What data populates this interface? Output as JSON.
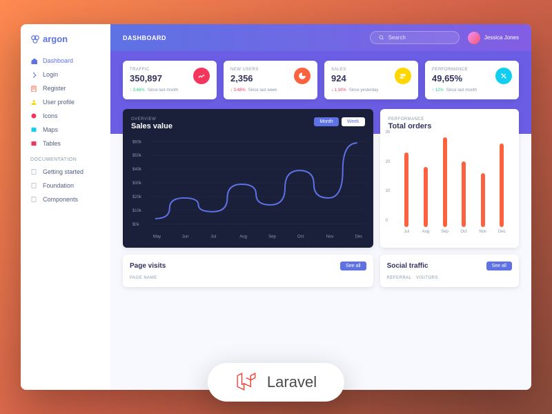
{
  "brand": "argon",
  "header": {
    "title": "DASHBOARD",
    "search_placeholder": "Search",
    "user_name": "Jessica Jones"
  },
  "nav": {
    "items": [
      {
        "label": "Dashboard",
        "icon": "home",
        "color": "#5e72e4"
      },
      {
        "label": "Login",
        "icon": "login",
        "color": "#5e72e4"
      },
      {
        "label": "Register",
        "icon": "register",
        "color": "#fb6340"
      },
      {
        "label": "User profile",
        "icon": "user",
        "color": "#ffd600"
      },
      {
        "label": "Icons",
        "icon": "icons",
        "color": "#f5365c"
      },
      {
        "label": "Maps",
        "icon": "map",
        "color": "#11cdef"
      },
      {
        "label": "Tables",
        "icon": "table",
        "color": "#f5365c"
      }
    ],
    "doc_title": "DOCUMENTATION",
    "doc_items": [
      {
        "label": "Getting started"
      },
      {
        "label": "Foundation"
      },
      {
        "label": "Components"
      }
    ]
  },
  "stats": [
    {
      "label": "TRAFFIC",
      "value": "350,897",
      "delta": "3.48%",
      "dir": "up",
      "since": "Since last month",
      "color": "#f5365c"
    },
    {
      "label": "NEW USERS",
      "value": "2,356",
      "delta": "3.48%",
      "dir": "down",
      "since": "Since last week",
      "color": "#fb6340"
    },
    {
      "label": "SALES",
      "value": "924",
      "delta": "1.10%",
      "dir": "down",
      "since": "Since yesterday",
      "color": "#ffd600"
    },
    {
      "label": "PERFORMANCE",
      "value": "49,65%",
      "delta": "12%",
      "dir": "up",
      "since": "Since last month",
      "color": "#11cdef"
    }
  ],
  "sales_chart": {
    "sub": "OVERVIEW",
    "title": "Sales value",
    "tab_month": "Month",
    "tab_week": "Week"
  },
  "orders_chart": {
    "sub": "PERFORMANCE",
    "title": "Total orders"
  },
  "page_visits": {
    "title": "Page visits",
    "see_all": "See all",
    "col1": "PAGE NAME"
  },
  "social": {
    "title": "Social traffic",
    "see_all": "See all",
    "col1": "REFERRAL",
    "col2": "VISITORS"
  },
  "badge": "Laravel",
  "chart_data": [
    {
      "type": "line",
      "title": "Sales value",
      "x": [
        "May",
        "Jun",
        "Jul",
        "Aug",
        "Sep",
        "Oct",
        "Nov",
        "Dec"
      ],
      "values": [
        5,
        20,
        10,
        30,
        15,
        40,
        20,
        60
      ],
      "ylabel": "",
      "ylim": [
        0,
        60
      ],
      "yticks": [
        "$60k",
        "$50k",
        "$40k",
        "$30k",
        "$20k",
        "$10k",
        "$0k"
      ]
    },
    {
      "type": "bar",
      "title": "Total orders",
      "categories": [
        "Jul",
        "Aug",
        "Sep",
        "Oct",
        "Nov",
        "Dec"
      ],
      "values": [
        25,
        20,
        30,
        22,
        18,
        28
      ],
      "ylim": [
        0,
        30
      ],
      "yticks": [
        30,
        20,
        10,
        0
      ]
    }
  ]
}
